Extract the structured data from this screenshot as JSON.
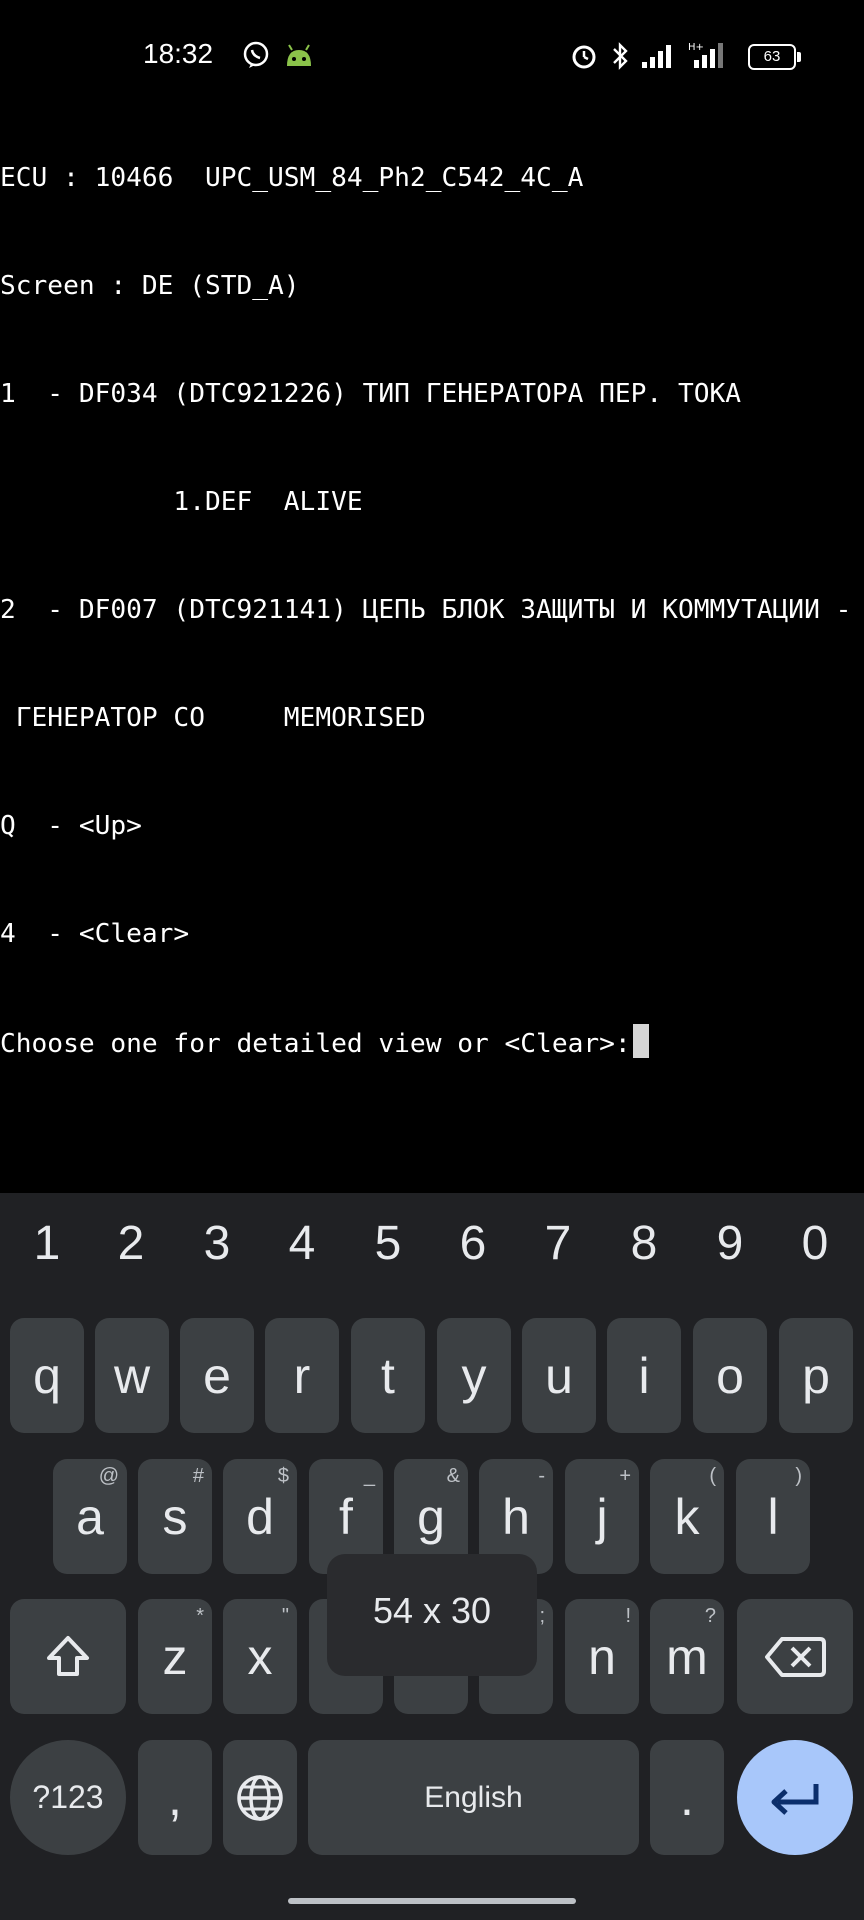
{
  "status_bar": {
    "time": "18:32",
    "battery": "63",
    "icons": [
      "viber-icon",
      "android-robot-icon",
      "alarm-icon",
      "bluetooth-icon",
      "signal-icon",
      "signal-hplus-icon",
      "battery-icon"
    ]
  },
  "terminal": {
    "lines": [
      "ECU : 10466  UPC_USM_84_Ph2_C542_4C_A",
      "Screen : DE (STD_A)",
      "1  - DF034 (DTC921226) ТИП ГЕНЕРАТОРА ПЕР. ТОКА",
      "           1.DEF  ALIVE",
      "2  - DF007 (DTC921141) ЦЕПЬ БЛОК ЗАЩИТЫ И КОММУТАЦИИ -",
      " ГЕНЕРАТОР CO     MEMORISED",
      "Q  - <Up>",
      "4  - <Clear>",
      "Choose one for detailed view or <Clear>:"
    ]
  },
  "keyboard": {
    "numbers": [
      "1",
      "2",
      "3",
      "4",
      "5",
      "6",
      "7",
      "8",
      "9",
      "0"
    ],
    "row1": [
      {
        "key": "q"
      },
      {
        "key": "w"
      },
      {
        "key": "e"
      },
      {
        "key": "r"
      },
      {
        "key": "t"
      },
      {
        "key": "y"
      },
      {
        "key": "u"
      },
      {
        "key": "i"
      },
      {
        "key": "o"
      },
      {
        "key": "p"
      }
    ],
    "row2": [
      {
        "key": "a",
        "hint": "@"
      },
      {
        "key": "s",
        "hint": "#"
      },
      {
        "key": "d",
        "hint": "$"
      },
      {
        "key": "f",
        "hint": "_"
      },
      {
        "key": "g",
        "hint": "&"
      },
      {
        "key": "h",
        "hint": "-"
      },
      {
        "key": "j",
        "hint": "+"
      },
      {
        "key": "k",
        "hint": "("
      },
      {
        "key": "l",
        "hint": ")"
      }
    ],
    "row3": [
      {
        "key": "z",
        "hint": "*"
      },
      {
        "key": "x",
        "hint": "\""
      },
      {
        "key": "",
        "hint": ""
      },
      {
        "key": "",
        "hint": ""
      },
      {
        "key": "",
        "hint": ";"
      },
      {
        "key": "n",
        "hint": "!"
      },
      {
        "key": "m",
        "hint": "?"
      }
    ],
    "symbols_label": "?123",
    "comma": ",",
    "space_label": "English",
    "period": ".",
    "size_popup": "54 x 30"
  }
}
